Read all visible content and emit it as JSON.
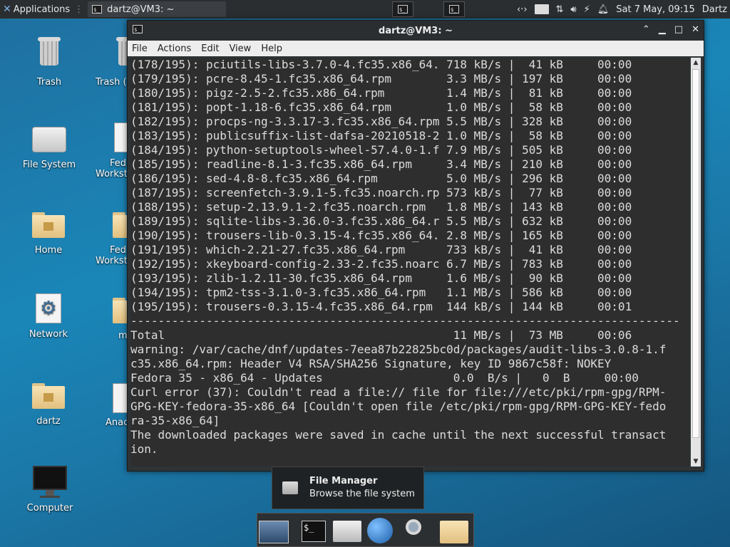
{
  "top_panel": {
    "applications_label": "Applications",
    "task_title": "dartz@VM3: ~",
    "datetime": "Sat  7 May, 09:15",
    "user": "Dartz"
  },
  "desktop_icons": [
    {
      "label": "Trash"
    },
    {
      "label": "Trash ("
    },
    {
      "label": "File System"
    },
    {
      "label": "Fed",
      "label2": "Workst"
    },
    {
      "label": "Home"
    },
    {
      "label": "Fed",
      "label2": "Workst"
    },
    {
      "label": "Network"
    },
    {
      "label": "m"
    },
    {
      "label": "dartz"
    },
    {
      "label": "Anac"
    },
    {
      "label": "Computer"
    }
  ],
  "window": {
    "title": "dartz@VM3: ~",
    "menu": [
      "File",
      "Actions",
      "Edit",
      "View",
      "Help"
    ]
  },
  "terminal_lines": [
    "(178/195): pciutils-libs-3.7.0-4.fc35.x86_64. 718 kB/s |  41 kB     00:00",
    "(179/195): pcre-8.45-1.fc35.x86_64.rpm        3.3 MB/s | 197 kB     00:00",
    "(180/195): pigz-2.5-2.fc35.x86_64.rpm         1.4 MB/s |  81 kB     00:00",
    "(181/195): popt-1.18-6.fc35.x86_64.rpm        1.0 MB/s |  58 kB     00:00",
    "(182/195): procps-ng-3.3.17-3.fc35.x86_64.rpm 5.5 MB/s | 328 kB     00:00",
    "(183/195): publicsuffix-list-dafsa-20210518-2 1.0 MB/s |  58 kB     00:00",
    "(184/195): python-setuptools-wheel-57.4.0-1.f 7.9 MB/s | 505 kB     00:00",
    "(185/195): readline-8.1-3.fc35.x86_64.rpm     3.4 MB/s | 210 kB     00:00",
    "(186/195): sed-4.8-8.fc35.x86_64.rpm          5.0 MB/s | 296 kB     00:00",
    "(187/195): screenfetch-3.9.1-5.fc35.noarch.rp 573 kB/s |  77 kB     00:00",
    "(188/195): setup-2.13.9.1-2.fc35.noarch.rpm   1.8 MB/s | 143 kB     00:00",
    "(189/195): sqlite-libs-3.36.0-3.fc35.x86_64.r 5.5 MB/s | 632 kB     00:00",
    "(190/195): trousers-lib-0.3.15-4.fc35.x86_64. 2.8 MB/s | 165 kB     00:00",
    "(191/195): which-2.21-27.fc35.x86_64.rpm      733 kB/s |  41 kB     00:00",
    "(192/195): xkeyboard-config-2.33-2.fc35.noarc 6.7 MB/s | 783 kB     00:00",
    "(193/195): zlib-1.2.11-30.fc35.x86_64.rpm     1.6 MB/s |  90 kB     00:00",
    "(194/195): tpm2-tss-3.1.0-3.fc35.x86_64.rpm   1.1 MB/s | 586 kB     00:00",
    "(195/195): trousers-0.3.15-4.fc35.x86_64.rpm  144 kB/s | 144 kB     00:01",
    "--------------------------------------------------------------------------------",
    "Total                                          11 MB/s |  73 MB     00:06",
    "warning: /var/cache/dnf/updates-7eea87b22825bc0d/packages/audit-libs-3.0.8-1.f",
    "c35.x86_64.rpm: Header V4 RSA/SHA256 Signature, key ID 9867c58f: NOKEY",
    "Fedora 35 - x86_64 - Updates                   0.0  B/s |   0  B     00:00",
    "Curl error (37): Couldn't read a file:// file for file:///etc/pki/rpm-gpg/RPM-",
    "GPG-KEY-fedora-35-x86_64 [Couldn't open file /etc/pki/rpm-gpg/RPM-GPG-KEY-fedo",
    "ra-35-x86_64]",
    "The downloaded packages were saved in cache until the next successful transact",
    "ion."
  ],
  "tooltip": {
    "title": "File Manager",
    "subtitle": "Browse the file system"
  },
  "dock_items": [
    "screen-icon",
    "terminal-icon",
    "home-folder-icon",
    "web-browser-icon",
    "search-icon",
    "folder-icon"
  ]
}
